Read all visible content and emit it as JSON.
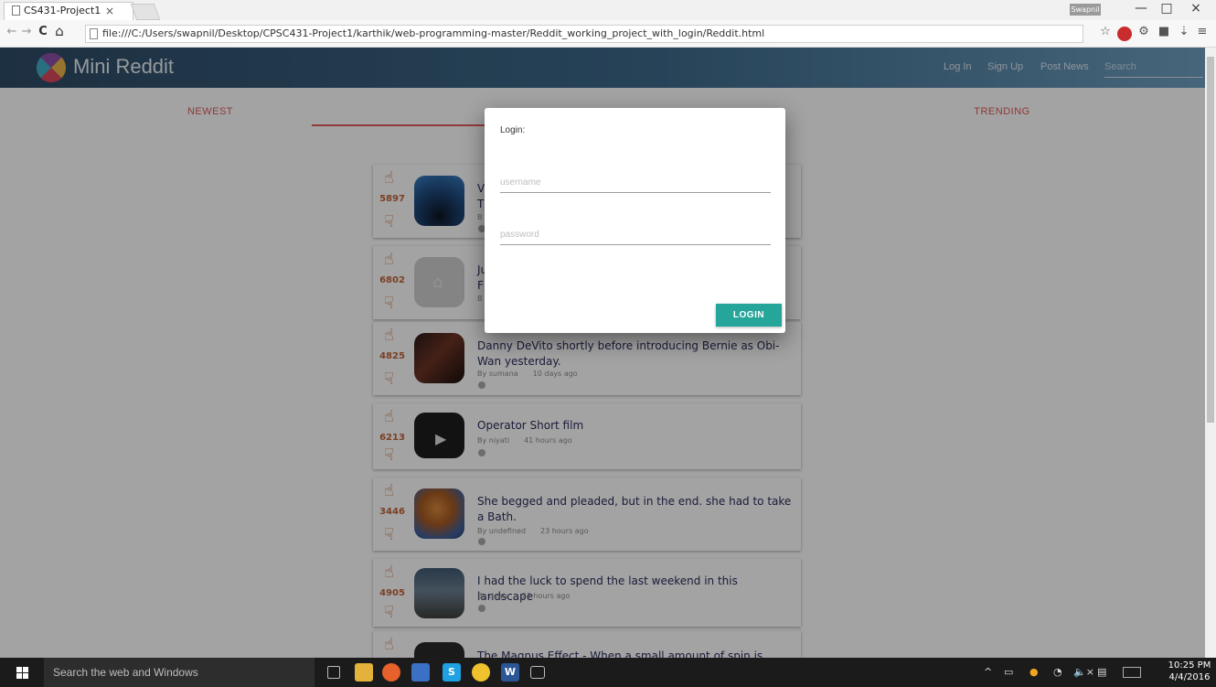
{
  "browser": {
    "tab_title": "CS431-Project1",
    "tab_close": "×",
    "user_badge": "Swapnil",
    "minimize": "—",
    "maximize": "□",
    "close": "×",
    "back": "←",
    "forward": "→",
    "reload": "C",
    "home": "⌂",
    "url": "file:///C:/Users/swapnil/Desktop/CPSC431-Project1/karthik/web-programming-master/Reddit_working_project_with_login/Reddit.html",
    "bookmark_star": "☆",
    "menu": "≡"
  },
  "app": {
    "brand": "Mini Reddit",
    "nav": {
      "login": "Log In",
      "signup": "Sign Up",
      "post_news": "Post News",
      "search_placeholder": "Search"
    },
    "tabs": [
      {
        "label": "NEWEST"
      },
      {
        "label": "TRENDING"
      }
    ],
    "posts": [
      {
        "score": "5897",
        "title": "V\nT",
        "author": "B",
        "time": ""
      },
      {
        "score": "6802",
        "title": "Ju\nF",
        "author": "B",
        "time": ""
      },
      {
        "score": "4825",
        "title": "Danny DeVito shortly before introducing Bernie as Obi-Wan yesterday.",
        "author": "By sumana",
        "time": "10 days ago"
      },
      {
        "score": "6213",
        "title": "Operator Short film",
        "author": "By niyati",
        "time": "41 hours ago"
      },
      {
        "score": "3446",
        "title": "She begged and pleaded, but in the end. she had to take a Bath.",
        "author": "By undefined",
        "time": "23 hours ago"
      },
      {
        "score": "4905",
        "title": "I had the luck to spend the last weekend in this landscape",
        "author": "By dean",
        "time": "23 hours ago"
      },
      {
        "score": "",
        "title": "The Magnus Effect - When a small amount of spin is added to",
        "author": "",
        "time": ""
      }
    ]
  },
  "modal": {
    "title": "Login:",
    "username_placeholder": "username",
    "password_placeholder": "password",
    "login_button": "LOGIN"
  },
  "taskbar": {
    "search_placeholder": "Search the web and Windows",
    "time": "10:25 PM",
    "date": "4/4/2016",
    "tray_chevron": "^",
    "volume": "🔈×"
  }
}
